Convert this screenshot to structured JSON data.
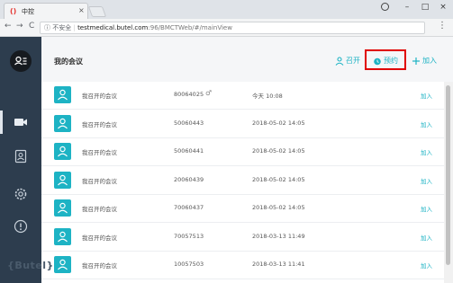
{
  "browser": {
    "tab_title": "中控",
    "tab_close": "×",
    "minimize": "–",
    "maximize": "□",
    "close": "×",
    "back": "←",
    "forward": "→",
    "reload": "C",
    "security_label": "ⓘ 不安全",
    "url_domain": "testmedical.butel.com",
    "url_path": ":96/BMCTWeb/#/mainView",
    "star": "☆",
    "menu": "⋮"
  },
  "app": {
    "brand": "{Butel}",
    "page_title": "我的会议",
    "actions": {
      "start_label": "召开",
      "schedule_label": "预约",
      "join_label": "加入"
    },
    "rows": [
      {
        "name": "我召开的会议",
        "id": "80064025",
        "has_key": true,
        "time": "今天 10:08"
      },
      {
        "name": "我召开的会议",
        "id": "50060443",
        "has_key": false,
        "time": "2018-05-02 14:05"
      },
      {
        "name": "我召开的会议",
        "id": "50060441",
        "has_key": false,
        "time": "2018-05-02 14:05"
      },
      {
        "name": "我召开的会议",
        "id": "20060439",
        "has_key": false,
        "time": "2018-05-02 14:05"
      },
      {
        "name": "我召开的会议",
        "id": "70060437",
        "has_key": false,
        "time": "2018-05-02 14:05"
      },
      {
        "name": "我召开的会议",
        "id": "70057513",
        "has_key": false,
        "time": "2018-03-13 11:49"
      },
      {
        "name": "我召开的会议",
        "id": "10057503",
        "has_key": false,
        "time": "2018-03-13 11:41"
      }
    ],
    "row_join_label": "加入",
    "key_symbol": "♂"
  },
  "colors": {
    "accent": "#1db3c4",
    "sidebar": "#2d3d4e",
    "highlight": "#e00000"
  }
}
